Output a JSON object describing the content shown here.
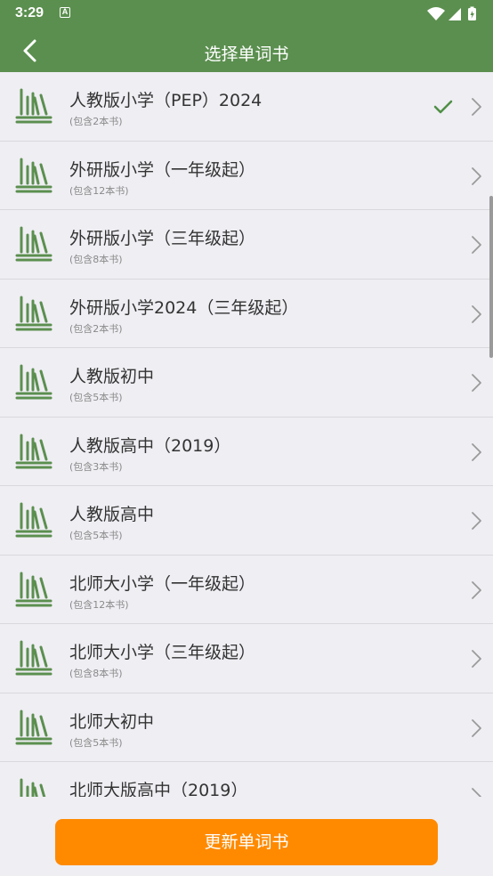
{
  "status": {
    "time": "3:29",
    "badge": "A"
  },
  "header": {
    "title": "选择单词书"
  },
  "books": [
    {
      "title": "人教版小学（PEP）2024",
      "count": "(包含2本书)",
      "selected": true
    },
    {
      "title": "外研版小学（一年级起）",
      "count": "(包含12本书)",
      "selected": false
    },
    {
      "title": "外研版小学（三年级起）",
      "count": "(包含8本书)",
      "selected": false
    },
    {
      "title": "外研版小学2024（三年级起）",
      "count": "(包含2本书)",
      "selected": false
    },
    {
      "title": "人教版初中",
      "count": "(包含5本书)",
      "selected": false
    },
    {
      "title": "人教版高中（2019）",
      "count": "(包含3本书)",
      "selected": false
    },
    {
      "title": "人教版高中",
      "count": "(包含5本书)",
      "selected": false
    },
    {
      "title": "北师大小学（一年级起）",
      "count": "(包含12本书)",
      "selected": false
    },
    {
      "title": "北师大小学（三年级起）",
      "count": "(包含8本书)",
      "selected": false
    },
    {
      "title": "北师大初中",
      "count": "(包含5本书)",
      "selected": false
    },
    {
      "title": "北师大版高中（2019）",
      "count": "",
      "selected": false
    }
  ],
  "footer": {
    "update_label": "更新单词书"
  },
  "colors": {
    "brand": "#5b8f4f",
    "accent": "#ff8a00",
    "check": "#4f8f45"
  },
  "icons": {
    "book": "book-shelf-icon",
    "check": "checkmark-icon",
    "chevron": "chevron-right-icon",
    "back": "back-arrow-icon"
  }
}
